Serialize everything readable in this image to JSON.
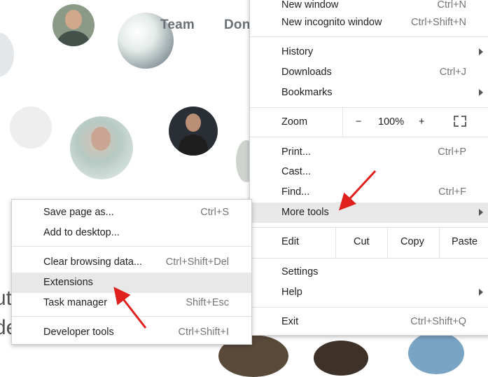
{
  "background": {
    "nav": [
      "Team",
      "Don"
    ],
    "partial_text": [
      "ut",
      "de"
    ]
  },
  "menu": {
    "items_top": [
      {
        "label": "New window",
        "shortcut": "Ctrl+N"
      },
      {
        "label": "New incognito window",
        "shortcut": "Ctrl+Shift+N"
      }
    ],
    "history": "History",
    "downloads": {
      "label": "Downloads",
      "shortcut": "Ctrl+J"
    },
    "bookmarks": "Bookmarks",
    "zoom": {
      "label": "Zoom",
      "minus": "−",
      "value": "100%",
      "plus": "+"
    },
    "print": {
      "label": "Print...",
      "shortcut": "Ctrl+P"
    },
    "cast": "Cast...",
    "find": {
      "label": "Find...",
      "shortcut": "Ctrl+F"
    },
    "more_tools": "More tools",
    "edit": {
      "label": "Edit",
      "cut": "Cut",
      "copy": "Copy",
      "paste": "Paste"
    },
    "settings": "Settings",
    "help": "Help",
    "exit": {
      "label": "Exit",
      "shortcut": "Ctrl+Shift+Q"
    }
  },
  "submenu": {
    "save_page": {
      "label": "Save page as...",
      "shortcut": "Ctrl+S"
    },
    "add_desktop": "Add to desktop...",
    "clear_data": {
      "label": "Clear browsing data...",
      "shortcut": "Ctrl+Shift+Del"
    },
    "extensions": "Extensions",
    "task_manager": {
      "label": "Task manager",
      "shortcut": "Shift+Esc"
    },
    "dev_tools": {
      "label": "Developer tools",
      "shortcut": "Ctrl+Shift+I"
    }
  },
  "colors": {
    "highlight": "#e8e8e8",
    "annotation_arrow": "#e0201c"
  }
}
